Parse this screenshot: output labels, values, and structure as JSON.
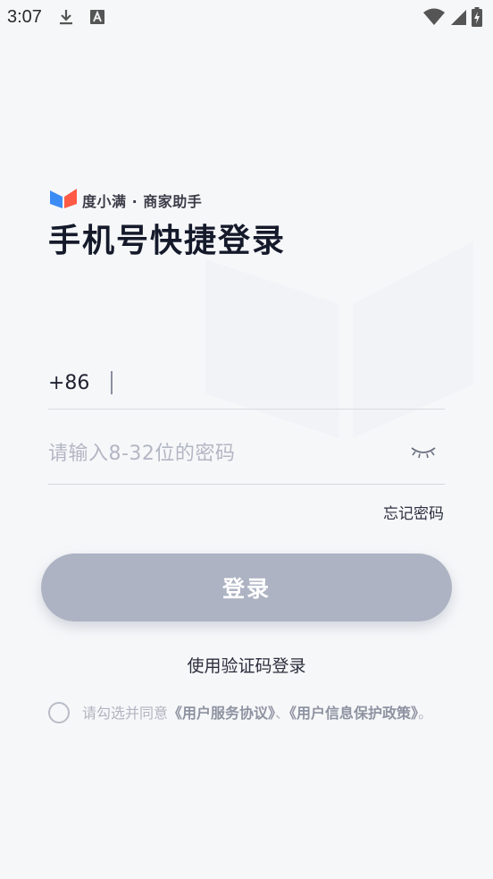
{
  "status_bar": {
    "time": "3:07",
    "icons": [
      "download-icon",
      "font-a-icon",
      "wifi-icon",
      "cellular-signal-icon",
      "battery-charging-icon"
    ]
  },
  "brand": {
    "name": "度小满 · 商家助手",
    "logo_colors": {
      "left": "#3b8cf5",
      "right": "#ff5a45"
    }
  },
  "title": "手机号快捷登录",
  "phone": {
    "country_code": "+86",
    "value": ""
  },
  "password": {
    "placeholder": "请输入8-32位的密码",
    "visibility_icon": "eye-closed-icon"
  },
  "forgot_password": "忘记密码",
  "login_button": "登录",
  "sms_login": "使用验证码登录",
  "agreement": {
    "prefix": "请勾选并同意",
    "link1": "《用户服务协议》",
    "separator": "、",
    "link2": "《用户信息保护政策》",
    "suffix": "。",
    "checked": false
  },
  "colors": {
    "background": "#f6f7f9",
    "button_disabled": "#adb3c3",
    "title": "#151a2b"
  }
}
